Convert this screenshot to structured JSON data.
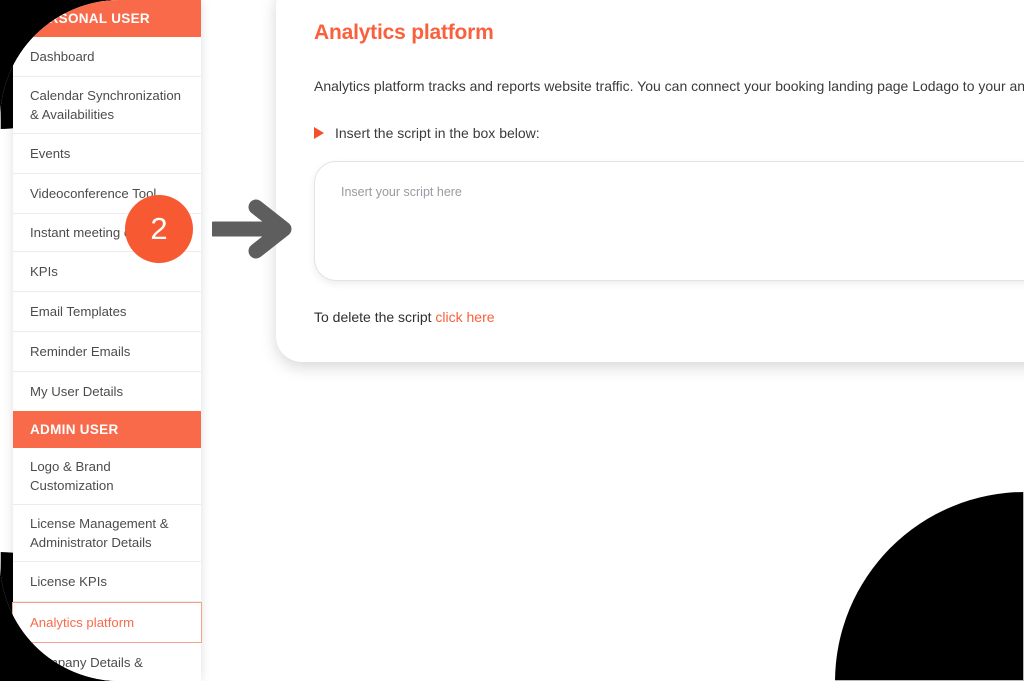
{
  "colors": {
    "accent": "#F96A4B",
    "accent_dark": "#F9603C",
    "arrow": "#5E5E5E",
    "badge": "#F75A33",
    "sidebar_text": "#4c4c4c"
  },
  "sidebar": {
    "sections": [
      {
        "label": "PERSONAL USER"
      },
      {
        "label": "ADMIN USER"
      }
    ],
    "personal_items": [
      {
        "label": "Dashboard"
      },
      {
        "label": "Calendar Synchronization & Availabilities"
      },
      {
        "label": "Events"
      },
      {
        "label": "Videoconference Tool"
      },
      {
        "label": "Instant meeting chat"
      },
      {
        "label": "KPIs"
      },
      {
        "label": "Email Templates"
      },
      {
        "label": "Reminder Emails"
      },
      {
        "label": "My User Details"
      }
    ],
    "admin_items": [
      {
        "label": "Logo & Brand Customization"
      },
      {
        "label": "License Management & Administrator Details"
      },
      {
        "label": "License KPIs"
      },
      {
        "label": "Analytics platform"
      },
      {
        "label": "Company Details &"
      }
    ]
  },
  "main": {
    "title": "Analytics platform",
    "description": "Analytics platform tracks and reports website traffic. You can connect your booking landing page Lodago to your an",
    "instruction": "Insert the script in the box below:",
    "script_placeholder": "Insert your script here",
    "script_value": "",
    "delete_text": "To delete the script",
    "delete_link": "click here"
  },
  "annotations": {
    "step_number": "2"
  }
}
